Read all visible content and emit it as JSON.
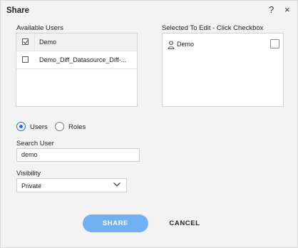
{
  "dialog": {
    "title": "Share",
    "help_icon": "?",
    "close_icon": "×"
  },
  "available_users": {
    "label": "Available Users",
    "rows": [
      {
        "name": "Demo",
        "checked": true
      },
      {
        "name": "Demo_Diff_Datasource_Diff-...",
        "checked": false
      }
    ]
  },
  "selected_to_edit": {
    "label": "Selected To Edit - Click Checkbox",
    "items": [
      {
        "icon": "user-icon",
        "name": "Demo"
      }
    ]
  },
  "mode": {
    "options": [
      "Users",
      "Roles"
    ],
    "selected": "Users"
  },
  "search": {
    "label": "Search User",
    "value": "demo"
  },
  "visibility": {
    "label": "Visibility",
    "selected": "Private"
  },
  "actions": {
    "share_label": "SHARE",
    "cancel_label": "CANCEL"
  },
  "colors": {
    "accent": "#1e6fd9",
    "share_button": "#6fb1f2",
    "dialog_background": "#f3f3f3"
  }
}
